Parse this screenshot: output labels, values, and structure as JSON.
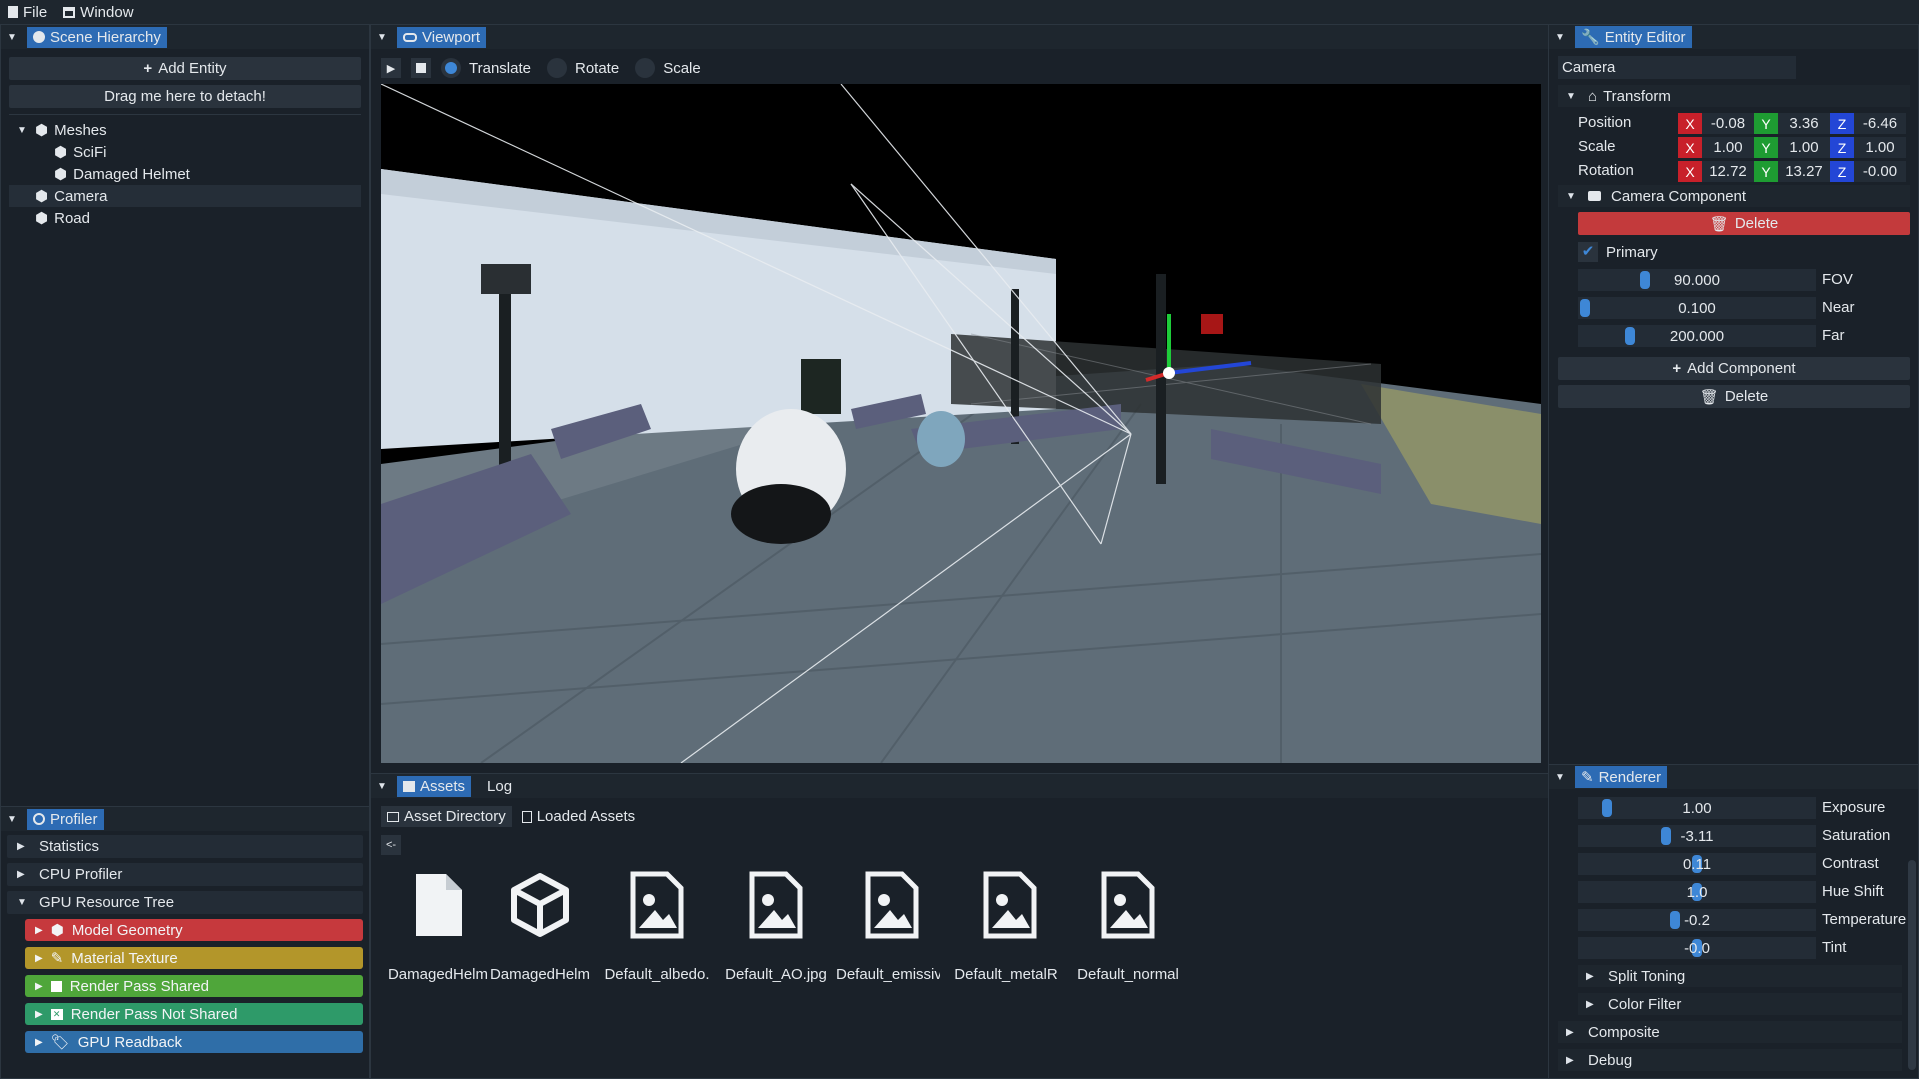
{
  "menu": {
    "file": "File",
    "window": "Window"
  },
  "hierarchy": {
    "tab": "Scene Hierarchy",
    "add_entity": "Add Entity",
    "detach": "Drag me here to detach!",
    "items": [
      {
        "label": "Meshes"
      },
      {
        "label": "SciFi"
      },
      {
        "label": "Damaged Helmet"
      },
      {
        "label": "Camera"
      },
      {
        "label": "Road"
      }
    ]
  },
  "profiler": {
    "tab": "Profiler",
    "sections": [
      "Statistics",
      "CPU Profiler",
      "GPU Resource Tree"
    ],
    "gpu": [
      {
        "label": "Model Geometry",
        "color": "#c6393d"
      },
      {
        "label": "Material Texture",
        "color": "#b3962a"
      },
      {
        "label": "Render Pass Shared",
        "color": "#4fa63a"
      },
      {
        "label": "Render Pass Not Shared",
        "color": "#2e9a69"
      },
      {
        "label": "GPU Readback",
        "color": "#2f6ea8"
      }
    ]
  },
  "viewport": {
    "tab": "Viewport",
    "modes": [
      "Translate",
      "Rotate",
      "Scale"
    ],
    "selected_mode": "Translate"
  },
  "assets": {
    "tab": "Assets",
    "log_tab": "Log",
    "dir_tab": "Asset Directory",
    "loaded_tab": "Loaded Assets",
    "back": "<-",
    "files": [
      {
        "name": "DamagedHelm",
        "icon": "file-icon"
      },
      {
        "name": "DamagedHelm",
        "icon": "cube-icon"
      },
      {
        "name": "Default_albedo.",
        "icon": "image-icon"
      },
      {
        "name": "Default_AO.jpg",
        "icon": "image-icon"
      },
      {
        "name": "Default_emissiv",
        "icon": "image-icon"
      },
      {
        "name": "Default_metalR",
        "icon": "image-icon"
      },
      {
        "name": "Default_normal",
        "icon": "image-icon"
      }
    ]
  },
  "editor": {
    "tab": "Entity Editor",
    "name": "Camera",
    "transform": "Transform",
    "position_label": "Position",
    "scale_label": "Scale",
    "rotation_label": "Rotation",
    "position": [
      "-0.08",
      "3.36",
      "-6.46"
    ],
    "scale": [
      "1.00",
      "1.00",
      "1.00"
    ],
    "rotation": [
      "12.72",
      "13.27",
      "-0.00"
    ],
    "axis": [
      "X",
      "Y",
      "Z"
    ],
    "camera_component": "Camera Component",
    "delete": "Delete",
    "primary": "Primary",
    "fov": {
      "label": "FOV",
      "value": "90.000",
      "fraction": 0.27
    },
    "near": {
      "label": "Near",
      "value": "0.100",
      "fraction": 0.0
    },
    "far": {
      "label": "Far",
      "value": "200.000",
      "fraction": 0.2
    },
    "add_component": "Add Component",
    "delete_entity": "Delete"
  },
  "renderer": {
    "tab": "Renderer",
    "sliders": [
      {
        "label": "Exposure",
        "value": "1.00",
        "fraction": 0.1
      },
      {
        "label": "Saturation",
        "value": "-3.11",
        "fraction": 0.36
      },
      {
        "label": "Contrast",
        "value": "0.11",
        "fraction": 0.5
      },
      {
        "label": "Hue Shift",
        "value": "1.0",
        "fraction": 0.5
      },
      {
        "label": "Temperature",
        "value": "-0.2",
        "fraction": 0.4
      },
      {
        "label": "Tint",
        "value": "-0.0",
        "fraction": 0.5
      }
    ],
    "sub_sections": [
      "Split Toning",
      "Color Filter"
    ],
    "sections": [
      "Composite",
      "Debug"
    ]
  },
  "colors": {
    "accent": "#2d6bb4",
    "danger": "#c33a3c",
    "slider_knob": "#3e87d6"
  }
}
